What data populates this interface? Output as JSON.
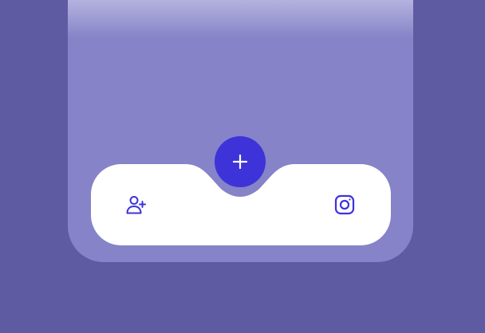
{
  "colors": {
    "page_background": "#5E5BA2",
    "screen_background": "#8683C8",
    "screen_top_fade": "#B4B2DE",
    "tabbar_background": "#FFFFFF",
    "accent": "#3D33D9",
    "fab_icon": "#FFFFFF"
  },
  "tabbar": {
    "items": [
      {
        "id": "add-user",
        "icon": "user-plus-icon"
      },
      {
        "id": "instagram",
        "icon": "instagram-icon"
      }
    ],
    "fab": {
      "icon": "plus-icon"
    }
  }
}
